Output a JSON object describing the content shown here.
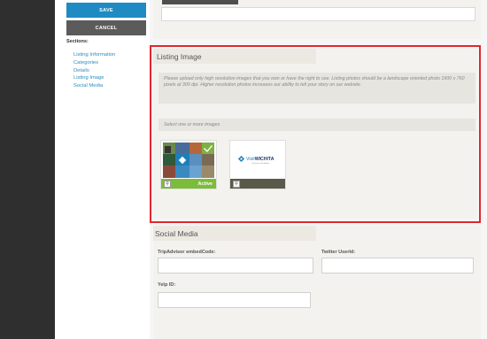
{
  "nav": {
    "save_label": "SAVE",
    "cancel_label": "CANCEL",
    "sections_title": "Sections:",
    "sections": [
      "Listing Information",
      "Categories",
      "Details",
      "Listing Image",
      "Social Media"
    ]
  },
  "listing_image": {
    "title": "Listing Image",
    "help_text": "Please upload only high resolution images that you own or have the right to use. Listing photos should be a landscape oriented photo 1900 x 760 pixels at 300 dpi. Higher resolution photos increases our ability to tell your story on our website.",
    "select_placeholder": "Select one or more images",
    "images": [
      {
        "status": "Active",
        "selected": true
      },
      {
        "status": "",
        "selected": false,
        "logo_text": "VisitWICHITA",
        "logo_tagline": "The Heart of the Midwest"
      }
    ]
  },
  "social_media": {
    "title": "Social Media",
    "tripadvisor_label": "TripAdvisor embedCode:",
    "twitter_label": "Twitter UserId:",
    "yelp_label": "Yelp ID:"
  },
  "colors": {
    "accent_blue": "#1e8bc3",
    "highlight_red": "#e2272c",
    "active_green": "#7bbd3b"
  }
}
